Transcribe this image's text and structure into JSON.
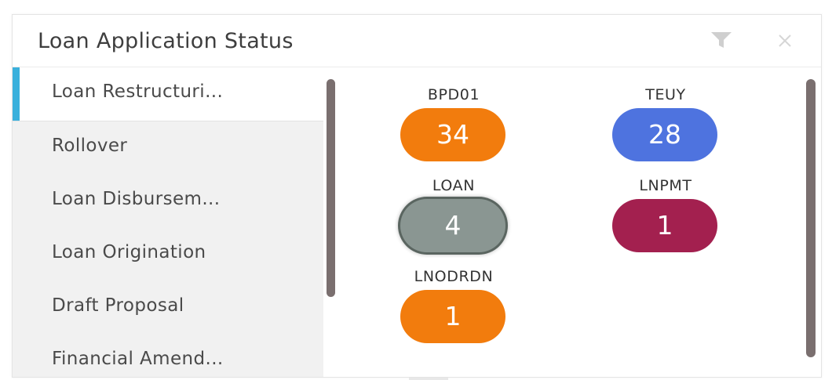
{
  "widget": {
    "title": "Loan Application Status",
    "icons": {
      "filter": "filter-icon",
      "close": "close-icon"
    }
  },
  "sidebar": {
    "active_index": 0,
    "accent_color": "#3ab0dc",
    "items": [
      {
        "label": "Loan Restructuri..."
      },
      {
        "label": "Rollover"
      },
      {
        "label": "Loan Disbursem..."
      },
      {
        "label": "Loan Origination"
      },
      {
        "label": "Draft Proposal"
      },
      {
        "label": "Financial Amend..."
      }
    ]
  },
  "statuses": [
    {
      "code": "BPD01",
      "count": "34",
      "color": "#f27c0d"
    },
    {
      "code": "TEUY",
      "count": "28",
      "color": "#4e73df"
    },
    {
      "code": "LOAN",
      "count": "4",
      "color": "#8a9692"
    },
    {
      "code": "LNPMT",
      "count": "1",
      "color": "#a3204f"
    },
    {
      "code": "LNODRDN",
      "count": "1",
      "color": "#f27c0d"
    }
  ]
}
